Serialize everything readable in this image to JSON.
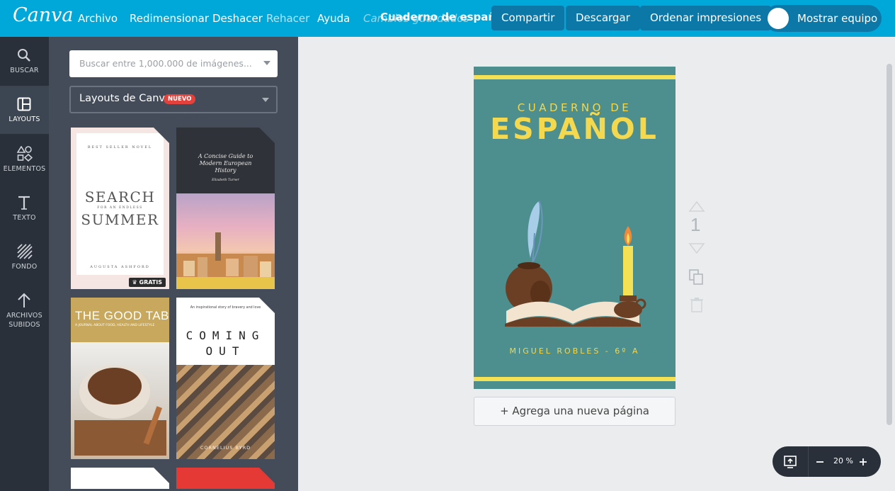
{
  "app": {
    "logo": "Canva"
  },
  "menu": {
    "archivo": "Archivo",
    "redimensionar": "Redimensionar",
    "deshacer": "Deshacer",
    "rehacer": "Rehacer",
    "ayuda": "Ayuda",
    "status": "Cambios guardados",
    "doc_title": "Cuaderno de español"
  },
  "actions": {
    "compartir": "Compartir",
    "descargar": "Descargar",
    "ordenar": "Ordenar impresiones",
    "mostrar_equipo": "Mostrar equipo"
  },
  "nav": [
    {
      "label": "BUSCAR",
      "icon": "search-icon"
    },
    {
      "label": "LAYOUTS",
      "icon": "layouts-icon"
    },
    {
      "label": "ELEMENTOS",
      "icon": "elements-icon"
    },
    {
      "label": "TEXTO",
      "icon": "text-icon"
    },
    {
      "label": "FONDO",
      "icon": "background-icon"
    },
    {
      "label": "ARCHIVOS",
      "label2": "SUBIDOS",
      "icon": "upload-icon"
    }
  ],
  "panel": {
    "search_placeholder": "Buscar entre 1,000.000 de imágenes...",
    "layout_select": "Layouts de Canva",
    "badge": "NUEVO",
    "gratis": "GRATIS"
  },
  "thumbs": {
    "t1": {
      "top": "BEST SELLER NOVEL",
      "line1": "SEARCH",
      "line2": "FOR AN ENDLESS",
      "line3": "SUMMER",
      "author": "AUGUSTA ASHFORD"
    },
    "t2": {
      "line1": "A Concise Guide to",
      "line2": "Modern European",
      "line3": "History",
      "author": "Elizabeth Turner"
    },
    "t3": {
      "title": "THE GOOD TABLE",
      "sub": "A JOURNAL ABOUT FOOD, HEALTH AND LIFESTYLE"
    },
    "t4": {
      "small": "An inspirational story of bravery and love",
      "line1": "COMING",
      "line2": "OUT",
      "author": "CORNELIUS BYRD"
    }
  },
  "page": {
    "subtitle": "CUADERNO DE",
    "title": "ESPAÑOL",
    "author": "MIGUEL ROBLES - 6º A",
    "number": "1",
    "add_page": "+ Agrega una nueva página"
  },
  "zoom": {
    "value": "20 %"
  },
  "colors": {
    "topbar": "#00a8d9",
    "cover_bg": "#4d8e8e",
    "cover_accent": "#f4e154"
  }
}
